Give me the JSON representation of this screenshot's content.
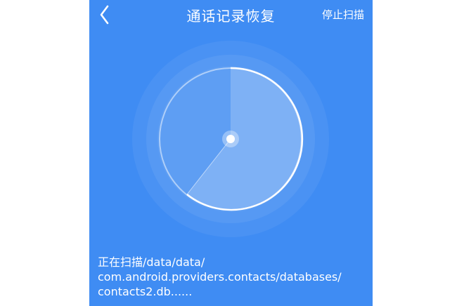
{
  "header": {
    "title": "通话记录恢复",
    "stop_label": "停止扫描"
  },
  "scan": {
    "status_line1": "正在扫描/data/data/",
    "status_line2": "com.android.providers.contacts/databases/",
    "status_line3": "contacts2.db......"
  },
  "icons": {
    "back": "chevron-left-icon"
  },
  "colors": {
    "background": "#3f8cf3",
    "ring": "#ffffff"
  }
}
